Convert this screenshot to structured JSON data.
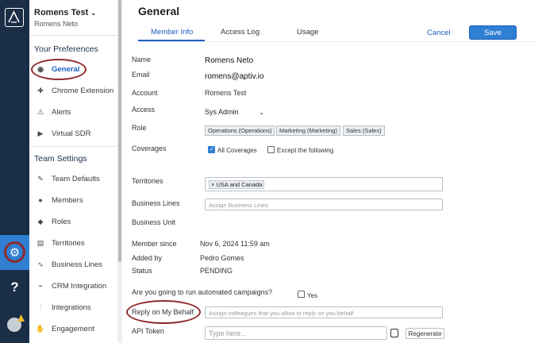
{
  "nav": {
    "org": "Romens Test",
    "user": "Romens Neto",
    "section_prefs": "Your Preferences",
    "prefs": [
      {
        "label": "General",
        "icon": "user-circle-icon"
      },
      {
        "label": "Chrome Extension",
        "icon": "puzzle-icon"
      },
      {
        "label": "Alerts",
        "icon": "bell-icon"
      },
      {
        "label": "Virtual SDR",
        "icon": "play-icon"
      }
    ],
    "section_team": "Team Settings",
    "team": [
      {
        "label": "Team Defaults",
        "icon": "wrench-icon"
      },
      {
        "label": "Members",
        "icon": "person-icon"
      },
      {
        "label": "Roles",
        "icon": "people-icon"
      },
      {
        "label": "Territories",
        "icon": "map-icon"
      },
      {
        "label": "Business Lines",
        "icon": "trend-icon"
      },
      {
        "label": "CRM Integration",
        "icon": "plug-icon"
      },
      {
        "label": "Integrations",
        "icon": "sliders-icon"
      },
      {
        "label": "Engagement",
        "icon": "handshake-icon"
      }
    ]
  },
  "header": {
    "title": "General",
    "tabs": [
      "Member Info",
      "Access Log",
      "Usage"
    ],
    "cancel": "Cancel",
    "save": "Save"
  },
  "form": {
    "name_label": "Name",
    "name_value": "Romens Neto",
    "email_label": "Email",
    "email_value": "romens@aptiv.io",
    "account_label": "Account",
    "account_value": "Romens Test",
    "access_label": "Access",
    "access_value": "Sys Admin",
    "role_label": "Role",
    "roles": [
      "Operations (Operations)",
      "Marketing (Marketing)",
      "Sales (Sales)"
    ],
    "coverages_label": "Coverages",
    "all_coverages": "All Coverages",
    "except": "Except the following",
    "territories_label": "Territories",
    "territory_tag": "USA and Canada",
    "business_lines_label": "Business Lines",
    "business_lines_placeholder": "Assign Business Lines",
    "business_unit_label": "Business Unit",
    "member_since_label": "Member since",
    "member_since_value": "Nov 6, 2024 11:59 am",
    "added_by_label": "Added by",
    "added_by_value": "Pedro Gomes",
    "status_label": "Status",
    "status_value": "PENDING",
    "campaigns_question": "Are you going to run automated campaigns?",
    "yes": "Yes",
    "reply_label": "Reply on My Behalf",
    "reply_placeholder": "Assign colleagues that you allow to reply on you behalf",
    "api_label": "API Token",
    "api_placeholder": "Type here...",
    "regenerate": "Regenerate"
  },
  "rail": {
    "help_icon_glyph": "?",
    "settings_icon_glyph": "⚙"
  },
  "colors": {
    "accent": "#2f7fd3",
    "rail": "#1b2e47",
    "annotation": "#8e2a2a"
  }
}
